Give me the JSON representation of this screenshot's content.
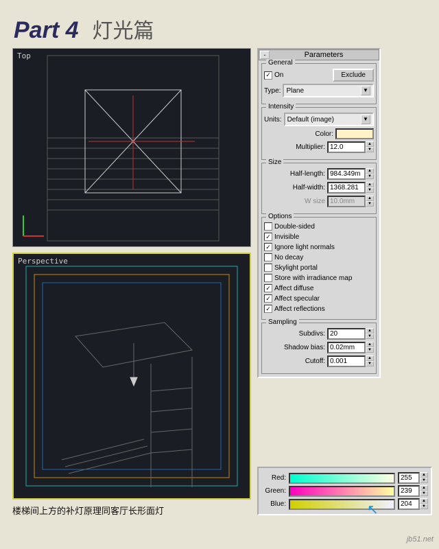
{
  "title": {
    "part": "Part 4",
    "sub": "灯光篇"
  },
  "viewports": {
    "top": {
      "label": "Top"
    },
    "perspective": {
      "label": "Perspective"
    },
    "caption": "楼梯间上方的补灯原理同客厅长形面灯"
  },
  "panel": {
    "header": "Parameters",
    "minus": "-",
    "general": {
      "title": "General",
      "on": {
        "label": "On",
        "checked": true
      },
      "exclude": "Exclude",
      "type_label": "Type:",
      "type_value": "Plane"
    },
    "intensity": {
      "title": "Intensity",
      "units_label": "Units:",
      "units_value": "Default (image)",
      "color_label": "Color:",
      "color_hex": "#fff1c8",
      "multiplier_label": "Multiplier:",
      "multiplier_value": "12.0"
    },
    "size": {
      "title": "Size",
      "half_length_label": "Half-length:",
      "half_length_value": "984.349m",
      "half_width_label": "Half-width:",
      "half_width_value": "1368.281",
      "w_size_label": "W size",
      "w_size_value": "10.0mm"
    },
    "options": {
      "title": "Options",
      "items": [
        {
          "label": "Double-sided",
          "checked": false
        },
        {
          "label": "Invisible",
          "checked": true
        },
        {
          "label": "Ignore light normals",
          "checked": true
        },
        {
          "label": "No decay",
          "checked": false
        },
        {
          "label": "Skylight portal",
          "checked": false
        },
        {
          "label": "Store with irradiance map",
          "checked": false
        },
        {
          "label": "Affect diffuse",
          "checked": true
        },
        {
          "label": "Affect specular",
          "checked": true
        },
        {
          "label": "Affect reflections",
          "checked": true
        }
      ]
    },
    "sampling": {
      "title": "Sampling",
      "subdivs_label": "Subdivs:",
      "subdivs_value": "20",
      "shadow_bias_label": "Shadow bias:",
      "shadow_bias_value": "0.02mm",
      "cutoff_label": "Cutoff:",
      "cutoff_value": "0.001"
    }
  },
  "rgb": {
    "red": {
      "label": "Red:",
      "value": "255",
      "grad_from": "#00ffd0",
      "grad_to": "#ffffe0"
    },
    "green": {
      "label": "Green:",
      "value": "239",
      "grad_from": "#ff00c0",
      "grad_to": "#ffffa0"
    },
    "blue": {
      "label": "Blue:",
      "value": "204",
      "grad_from": "#d0d000",
      "grad_to": "#f0f0ff"
    }
  },
  "watermark": "jb51.net"
}
